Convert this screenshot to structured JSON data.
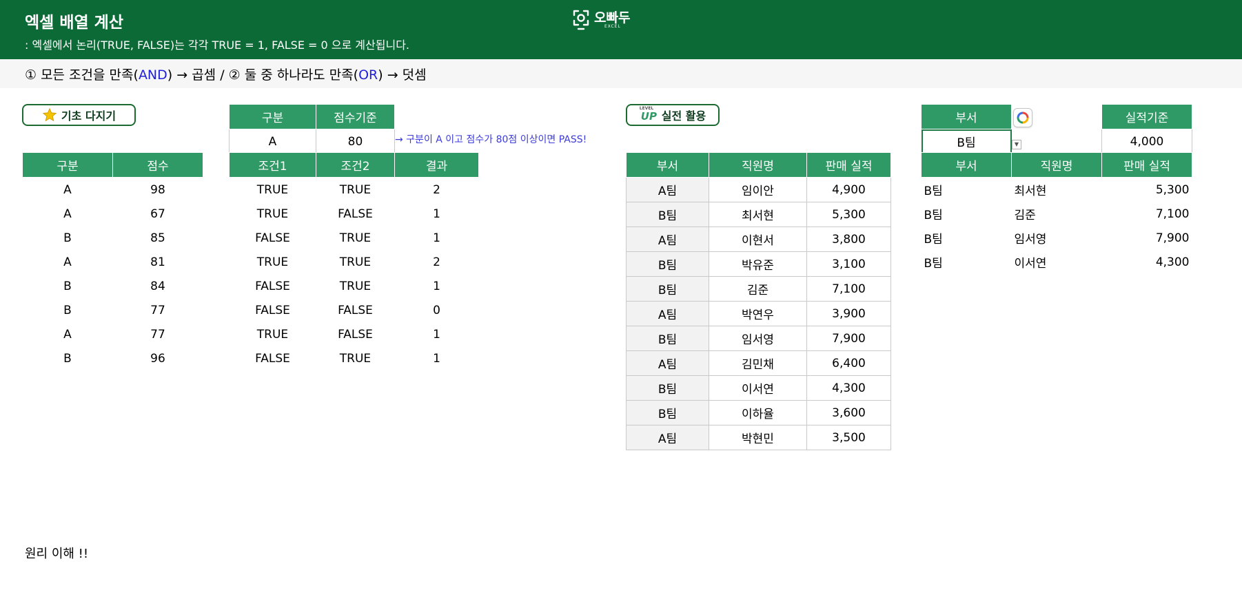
{
  "header": {
    "title": "엑셀 배열 계산",
    "subtitle": ": 엑셀에서 논리(TRUE, FALSE)는 각각 TRUE = 1, FALSE = 0 으로 계산됩니다.",
    "logo_text": "오빠두",
    "logo_sub": "EXCEL"
  },
  "rule_line": {
    "part1": "① 모든 조건을 만족(",
    "and": "AND",
    "part2": ") → 곱셈 / ② 둘 중 하나라도 만족(",
    "or": "OR",
    "part3": ") → 덧셈"
  },
  "badges": {
    "basic": {
      "label": "기초 다지기",
      "icon": "star-icon"
    },
    "practical": {
      "label": "실전 활용",
      "icon": "level-up-icon",
      "icon_top": "LEVEL",
      "icon_bottom": "UP"
    }
  },
  "scores_table": {
    "headers": [
      "구분",
      "점수"
    ],
    "rows": [
      [
        "A",
        "98"
      ],
      [
        "A",
        "67"
      ],
      [
        "B",
        "85"
      ],
      [
        "A",
        "81"
      ],
      [
        "B",
        "84"
      ],
      [
        "B",
        "77"
      ],
      [
        "A",
        "77"
      ],
      [
        "B",
        "96"
      ]
    ]
  },
  "criteria": {
    "headers": [
      "구분",
      "점수기준"
    ],
    "values": [
      "A",
      "80"
    ],
    "note": "→ 구분이 A 이고 점수가 80점 이상이면 PASS!"
  },
  "conditions_table": {
    "headers": [
      "조건1",
      "조건2",
      "결과"
    ],
    "rows": [
      [
        "TRUE",
        "TRUE",
        "2"
      ],
      [
        "TRUE",
        "FALSE",
        "1"
      ],
      [
        "FALSE",
        "TRUE",
        "1"
      ],
      [
        "TRUE",
        "TRUE",
        "2"
      ],
      [
        "FALSE",
        "TRUE",
        "1"
      ],
      [
        "FALSE",
        "FALSE",
        "0"
      ],
      [
        "TRUE",
        "FALSE",
        "1"
      ],
      [
        "FALSE",
        "TRUE",
        "1"
      ]
    ]
  },
  "sales_table": {
    "headers": [
      "부서",
      "직원명",
      "판매 실적"
    ],
    "rows": [
      [
        "A팀",
        "임이안",
        "4,900"
      ],
      [
        "B팀",
        "최서현",
        "5,300"
      ],
      [
        "A팀",
        "이현서",
        "3,800"
      ],
      [
        "B팀",
        "박유준",
        "3,100"
      ],
      [
        "B팀",
        "김준",
        "7,100"
      ],
      [
        "A팀",
        "박연우",
        "3,900"
      ],
      [
        "B팀",
        "임서영",
        "7,900"
      ],
      [
        "A팀",
        "김민채",
        "6,400"
      ],
      [
        "B팀",
        "이서연",
        "4,300"
      ],
      [
        "B팀",
        "이하율",
        "3,600"
      ],
      [
        "A팀",
        "박현민",
        "3,500"
      ]
    ]
  },
  "filter": {
    "dept_header": "부서",
    "dept_value": "B팀",
    "perf_header": "실적기준",
    "perf_value": "4,000"
  },
  "filter_result": {
    "headers": [
      "부서",
      "직원명",
      "판매 실적"
    ],
    "rows": [
      [
        "B팀",
        "최서현",
        "5,300"
      ],
      [
        "B팀",
        "김준",
        "7,100"
      ],
      [
        "B팀",
        "임서영",
        "7,900"
      ],
      [
        "B팀",
        "이서연",
        "4,300"
      ]
    ]
  },
  "bottom_text": "원리 이해 !!",
  "colors": {
    "banner": "#0c6a37",
    "header_fill": "#2f9a65",
    "badge_border": "#1b6b30",
    "note": "#3b3bd9",
    "highlight": "#1f1fd6"
  }
}
